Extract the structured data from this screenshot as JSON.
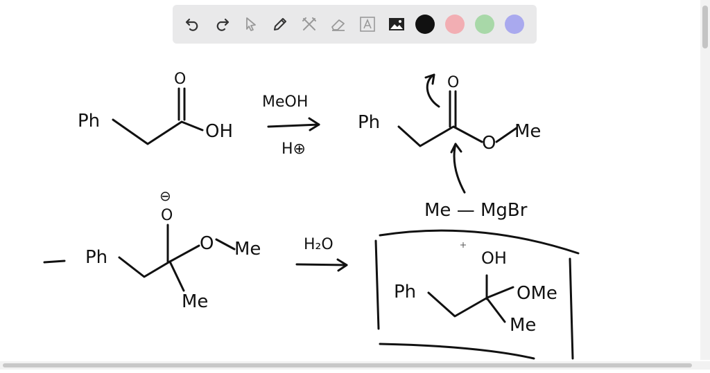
{
  "toolbar": {
    "tools": [
      {
        "name": "undo-icon",
        "label": "Undo"
      },
      {
        "name": "redo-icon",
        "label": "Redo"
      },
      {
        "name": "pointer-icon",
        "label": "Select"
      },
      {
        "name": "pen-icon",
        "label": "Pen"
      },
      {
        "name": "tools-icon",
        "label": "Tools"
      },
      {
        "name": "eraser-icon",
        "label": "Eraser"
      },
      {
        "name": "text-icon",
        "label": "Text"
      },
      {
        "name": "image-icon",
        "label": "Image"
      }
    ],
    "colors": [
      "#111111",
      "#f2aeb3",
      "#a8d8a8",
      "#a9a9ee"
    ]
  },
  "canvas": {
    "r1": {
      "reactant_ph": "Ph",
      "reactant_o": "O",
      "reactant_oh": "OH",
      "reagent_top": "MeOH",
      "reagent_bottom": "H⊕",
      "product_ph": "Ph",
      "product_o": "O",
      "product_ome": "O",
      "product_me": "Me"
    },
    "grignard": "Me — MgBr",
    "r2": {
      "inter_charge": "⊖",
      "inter_o": "O",
      "inter_ph": "Ph",
      "inter_o2": "O",
      "inter_me1": "Me",
      "inter_me2": "Me",
      "reagent": "H₂O",
      "final_ph": "Ph",
      "final_oh": "OH",
      "final_ome": "OMe",
      "final_me": "Me"
    }
  }
}
